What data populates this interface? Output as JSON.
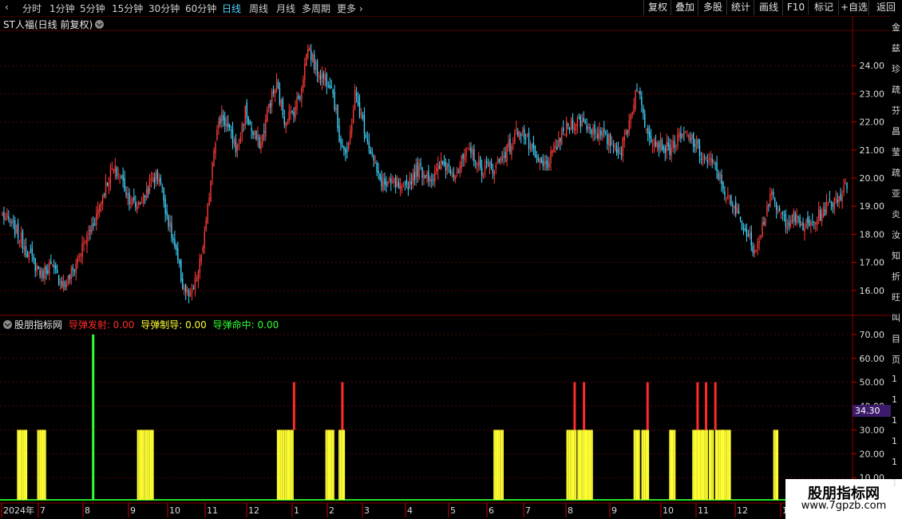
{
  "toolbar": {
    "periods": [
      "分时",
      "1分钟",
      "5分钟",
      "15分钟",
      "30分钟",
      "60分钟",
      "日线",
      "周线",
      "月线",
      "多周期",
      "更多"
    ],
    "active_period": "日线",
    "right_buttons": [
      "复权",
      "叠加",
      "多股",
      "统计",
      "画线",
      "F10",
      "标记",
      "+自选",
      "返回"
    ]
  },
  "main_chart": {
    "title": "ST人福(日线 前复权)",
    "y_ticks": [
      "24.00",
      "23.00",
      "22.00",
      "21.00",
      "20.00",
      "19.00",
      "18.00",
      "17.00",
      "16.00"
    ],
    "y_values": [
      24,
      23,
      22,
      21,
      20,
      19,
      18,
      17,
      16
    ],
    "up_color": "#ff3b3b",
    "down_color": "#3fd6ff"
  },
  "indicator": {
    "name": "股朋指标网",
    "series": [
      {
        "label": "导弹发射:",
        "value": "0.00",
        "color": "#ff2a2a"
      },
      {
        "label": "导弹制导:",
        "value": "0.00",
        "color": "#ffff33"
      },
      {
        "label": "导弹命中:",
        "value": "0.00",
        "color": "#33ff33"
      }
    ],
    "y_ticks": [
      "70.00",
      "60.00",
      "50.00",
      "40.00",
      "30.00",
      "20.00",
      "10.00"
    ],
    "current_value": "34.30"
  },
  "x_axis": {
    "labels": [
      "2024年",
      "7",
      "8",
      "9",
      "10",
      "11",
      "12",
      "1",
      "2",
      "3",
      "4",
      "5",
      "6",
      "7",
      "8",
      "9",
      "10",
      "11",
      "12",
      "1"
    ]
  },
  "right_column": {
    "chars": [
      "金",
      "兹",
      "珍",
      "疏",
      "芬",
      "昌",
      "莹",
      "疏",
      "亚",
      "炎",
      "汝",
      "知",
      "折",
      "旺",
      "叫",
      "目",
      "页",
      "1",
      "1",
      "1",
      "1",
      "1",
      "1"
    ]
  },
  "watermark": {
    "name": "股朋指标网",
    "url": "www.7gpzb.com"
  },
  "chart_data": [
    {
      "type": "candlestick",
      "title": "ST人福(日线 前复权)",
      "ylim": [
        15.2,
        25.2
      ],
      "x_labels": [
        "2024年",
        "7",
        "8",
        "9",
        "10",
        "11",
        "12",
        "1",
        "2",
        "3",
        "4",
        "5",
        "6",
        "7",
        "8",
        "9",
        "10",
        "11",
        "12",
        "1"
      ],
      "close_path": [
        18.7,
        18.4,
        18.0,
        17.5,
        17.0,
        16.6,
        16.9,
        16.5,
        16.2,
        16.7,
        17.4,
        18.0,
        18.7,
        19.6,
        20.3,
        20.1,
        19.4,
        19.0,
        19.3,
        19.9,
        20.1,
        18.7,
        17.5,
        16.2,
        15.7,
        16.6,
        18.3,
        21.2,
        22.3,
        21.6,
        21.0,
        22.4,
        21.5,
        21.2,
        22.6,
        23.3,
        22.1,
        22.3,
        23.0,
        24.7,
        23.9,
        23.6,
        23.4,
        21.5,
        20.7,
        23.0,
        22.0,
        21.0,
        20.0,
        19.7,
        19.8,
        19.5,
        19.9,
        20.3,
        20.2,
        20.0,
        20.5,
        20.4,
        20.2,
        20.8,
        20.9,
        20.3,
        20.4,
        20.4,
        20.9,
        21.2,
        21.8,
        21.3,
        20.7,
        20.4,
        20.7,
        21.3,
        21.8,
        22.0,
        22.0,
        21.8,
        21.6,
        21.4,
        21.2,
        21.0,
        22.0,
        23.3,
        22.0,
        21.4,
        21.2,
        21.0,
        21.3,
        21.5,
        21.4,
        20.9,
        20.6,
        20.4,
        19.7,
        19.0,
        18.7,
        18.0,
        17.5,
        18.3,
        19.4,
        18.8,
        18.5,
        18.6,
        18.3,
        18.3,
        18.6,
        18.9,
        19.2,
        19.4,
        19.8
      ]
    },
    {
      "type": "bar",
      "title": "股朋指标网",
      "ylim": [
        0,
        75
      ],
      "series": [
        {
          "name": "导弹制导",
          "color": "#ffff33",
          "value": 30,
          "positions": [
            0.025,
            0.048,
            0.165,
            0.175,
            0.33,
            0.34,
            0.388,
            0.402,
            0.587,
            0.673,
            0.686,
            0.693,
            0.75,
            0.76,
            0.792,
            0.82,
            0.828,
            0.838,
            0.847,
            0.855,
            0.914
          ]
        },
        {
          "name": "导弹发射",
          "color": "#ff2a2a",
          "value": 50,
          "positions": [
            0.345,
            0.402,
            0.676,
            0.687,
            0.762,
            0.821,
            0.831,
            0.842
          ]
        },
        {
          "name": "导弹命中",
          "color": "#33ff33",
          "value": 70,
          "positions": [
            0.108
          ]
        }
      ]
    }
  ]
}
